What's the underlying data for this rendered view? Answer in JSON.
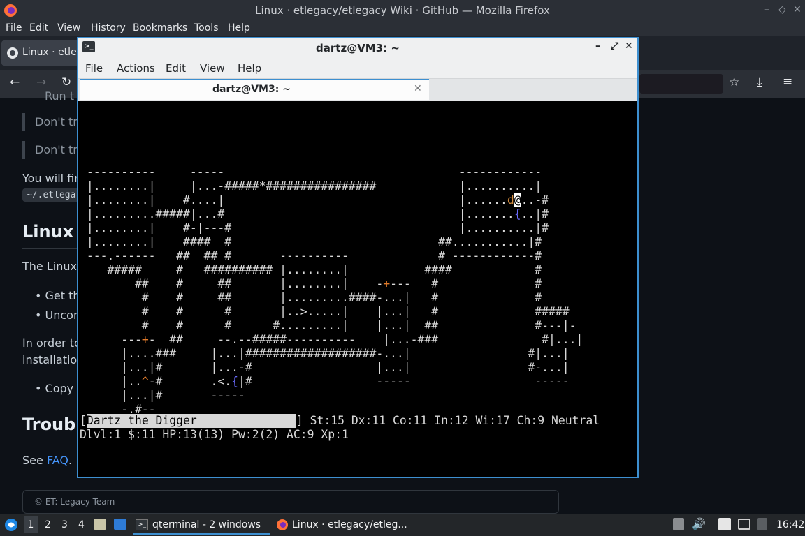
{
  "firefox": {
    "title": "Linux · etlegacy/etlegacy Wiki · GitHub — Mozilla Firefox",
    "menu": [
      "File",
      "Edit",
      "View",
      "History",
      "Bookmarks",
      "Tools",
      "Help"
    ],
    "tab_label": "Linux · etle"
  },
  "page": {
    "partial_top": "Run t",
    "quote1": "Don't try",
    "quote2": "Don't try",
    "para1": "You will find",
    "code1": "~/.etlega",
    "heading1": "Linux A",
    "para2": "The Linux a",
    "bullet1": "Get the",
    "bullet2": "Uncom",
    "para3a": "In order to",
    "para3b": "installation.",
    "bullet3": "Copy t",
    "heading2": "Trouble",
    "see_prefix": "See ",
    "faq_link": "FAQ",
    "see_suffix": ".",
    "footer": "© ET: Legacy Team"
  },
  "terminal": {
    "title": "dartz@VM3: ~",
    "menu": [
      "File",
      "Actions",
      "Edit",
      "View",
      "Help"
    ],
    "tab_title": "dartz@VM3: ~",
    "map_lines": [
      "",
      "",
      " ----------     -----                                  ------------",
      " |........|     |...-#####*################            |..........|",
      " |........|    #....|                                  |......d@..-#",
      " |.........#####|...#                                  |.......{..|#",
      " |........|    #-|---#                                 |..........|#",
      " |........|    ####  #                              ##...........|#",
      " ---.------   ##  ## #       ----------             # ------------#",
      "    #####     #   ########## |........|           ####            #",
      "        ##    #     ##       |........|    -+---   #              #",
      "         #    #     ##       |.........####-...|   #              #",
      "         #    #      #       |..>.....|    |...|   #              #####",
      "         #    #      #      #.........|    |...|  ##              #---|-",
      "      ---+-  ##     --.--#####----------    |...-###               #|...|",
      "      |....###     |...|###################-...|                 #|...|",
      "      |...|#       |...-#                  |...|                 #-...|",
      "      |..^-#       .<.{|#                  -----                  -----",
      "      |...|#       -----",
      "      -.#--",
      "        ##"
    ],
    "player_name": "Dartz the Digger",
    "status_attrs": "] St:15 Dx:11 Co:11 In:12 Wi:17 Ch:9 Neutral",
    "status_line2": "Dlvl:1 $:11 HP:13(13) Pw:2(2) AC:9 Xp:1"
  },
  "taskbar": {
    "workspaces": [
      "1",
      "2",
      "3",
      "4"
    ],
    "task1": "qterminal - 2 windows",
    "task2": "Linux · etlegacy/etleg...",
    "clock": "16:42"
  }
}
